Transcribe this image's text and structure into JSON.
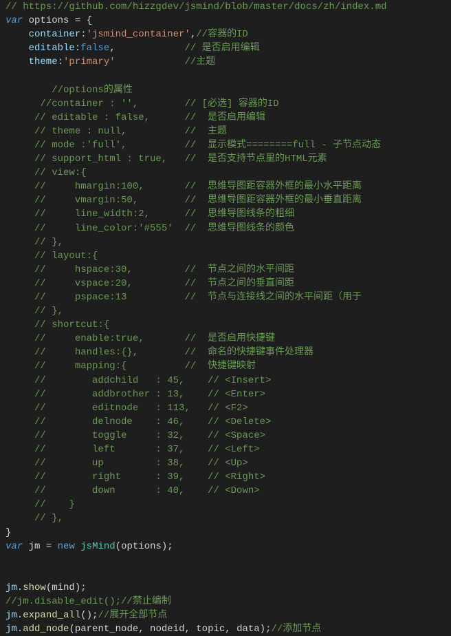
{
  "code": {
    "l00": "// https://github.com/hizzgdev/jsmind/blob/master/docs/zh/index.md",
    "l01a": "var",
    "l01b": " options = {",
    "l02a": "    container:",
    "l02b": "'jsmind_container'",
    "l02c": ",",
    "l02d": "//容器的ID",
    "l03a": "    editable:",
    "l03b": "false",
    "l03c": ",            ",
    "l03d": "// 是否启用编辑",
    "l04a": "    theme:",
    "l04b": "'primary'",
    "l04c": "            ",
    "l04d": "//主题",
    "l05": "",
    "l06": "        //options的属性",
    "l07": "      //container : '',        // [必选] 容器的ID",
    "l08": "     // editable : false,      //  是否启用编辑",
    "l09": "     // theme : null,          //  主题",
    "l10": "     // mode :'full',          //  显示模式========full - 子节点动态",
    "l11": "     // support_html : true,   //  是否支持节点里的HTML元素",
    "l12": "     // view:{",
    "l13": "     //     hmargin:100,       //  思维导图距容器外框的最小水平距离",
    "l14": "     //     vmargin:50,        //  思维导图距容器外框的最小垂直距离",
    "l15": "     //     line_width:2,      //  思维导图线条的粗细",
    "l16": "     //     line_color:'#555'  //  思维导图线条的颜色",
    "l17": "     // },",
    "l18": "     // layout:{",
    "l19": "     //     hspace:30,         //  节点之间的水平间距",
    "l20": "     //     vspace:20,         //  节点之间的垂直间距",
    "l21": "     //     pspace:13          //  节点与连接线之间的水平间距（用于",
    "l22": "     // },",
    "l23": "     // shortcut:{",
    "l24": "     //     enable:true,       //  是否启用快捷键",
    "l25": "     //     handles:{},        //  命名的快捷键事件处理器",
    "l26": "     //     mapping:{          //  快捷键映射",
    "l27": "     //        addchild   : 45,    // <Insert>",
    "l28": "     //        addbrother : 13,    // <Enter>",
    "l29": "     //        editnode   : 113,   // <F2>",
    "l30": "     //        delnode    : 46,    // <Delete>",
    "l31": "     //        toggle     : 32,    // <Space>",
    "l32": "     //        left       : 37,    // <Left>",
    "l33": "     //        up         : 38,    // <Up>",
    "l34": "     //        right      : 39,    // <Right>",
    "l35": "     //        down       : 40,    // <Down>",
    "l36": "     //    }",
    "l37": "     // },",
    "l38": "}",
    "l39a": "var",
    "l39b": " jm = ",
    "l39c": "new",
    "l39d": " ",
    "l39e": "jsMind",
    "l39f": "(options);",
    "l40": "",
    "l41": "",
    "l42a": "jm.",
    "l42b": "show",
    "l42c": "(mind);",
    "l43": "//jm.disable_edit();//禁止编制",
    "l44a": "jm.",
    "l44b": "expand_all",
    "l44c": "();",
    "l44d": "//展开全部节点",
    "l45a": "jm.",
    "l45b": "add_node",
    "l45c": "(parent_node, nodeid, topic, data);",
    "l45d": "//添加节点"
  }
}
